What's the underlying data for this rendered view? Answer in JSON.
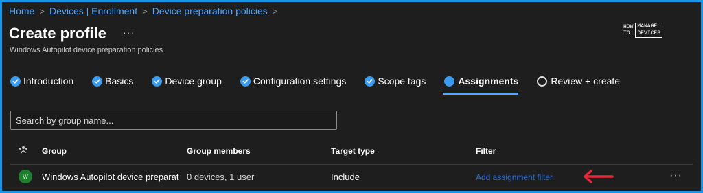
{
  "breadcrumb": {
    "items": [
      "Home",
      "Devices | Enrollment",
      "Device preparation policies"
    ],
    "separator": ">"
  },
  "header": {
    "title": "Create profile",
    "more_label": "···",
    "subtitle": "Windows Autopilot device preparation policies"
  },
  "logo": {
    "line1": "HOW",
    "line2": "TO",
    "line3": "MANAGE",
    "line4": "DEVICES"
  },
  "wizard": {
    "tabs": [
      {
        "label": "Introduction",
        "state": "complete"
      },
      {
        "label": "Basics",
        "state": "complete"
      },
      {
        "label": "Device group",
        "state": "complete"
      },
      {
        "label": "Configuration settings",
        "state": "complete"
      },
      {
        "label": "Scope tags",
        "state": "complete"
      },
      {
        "label": "Assignments",
        "state": "current"
      },
      {
        "label": "Review + create",
        "state": "pending"
      }
    ]
  },
  "search": {
    "placeholder": "Search by group name...",
    "value": ""
  },
  "table": {
    "columns": [
      "Group",
      "Group members",
      "Target type",
      "Filter"
    ],
    "rows": [
      {
        "avatar": "W",
        "group": "Windows Autopilot device preparati",
        "members": "0 devices, 1 user",
        "target_type": "Include",
        "filter": "Add assignment filter",
        "more": "···"
      }
    ]
  },
  "colors": {
    "accent": "#4ea8ff",
    "frame_border": "#1596e8",
    "arrow": "#e8263a",
    "avatar_bg": "#1e7f2e"
  }
}
